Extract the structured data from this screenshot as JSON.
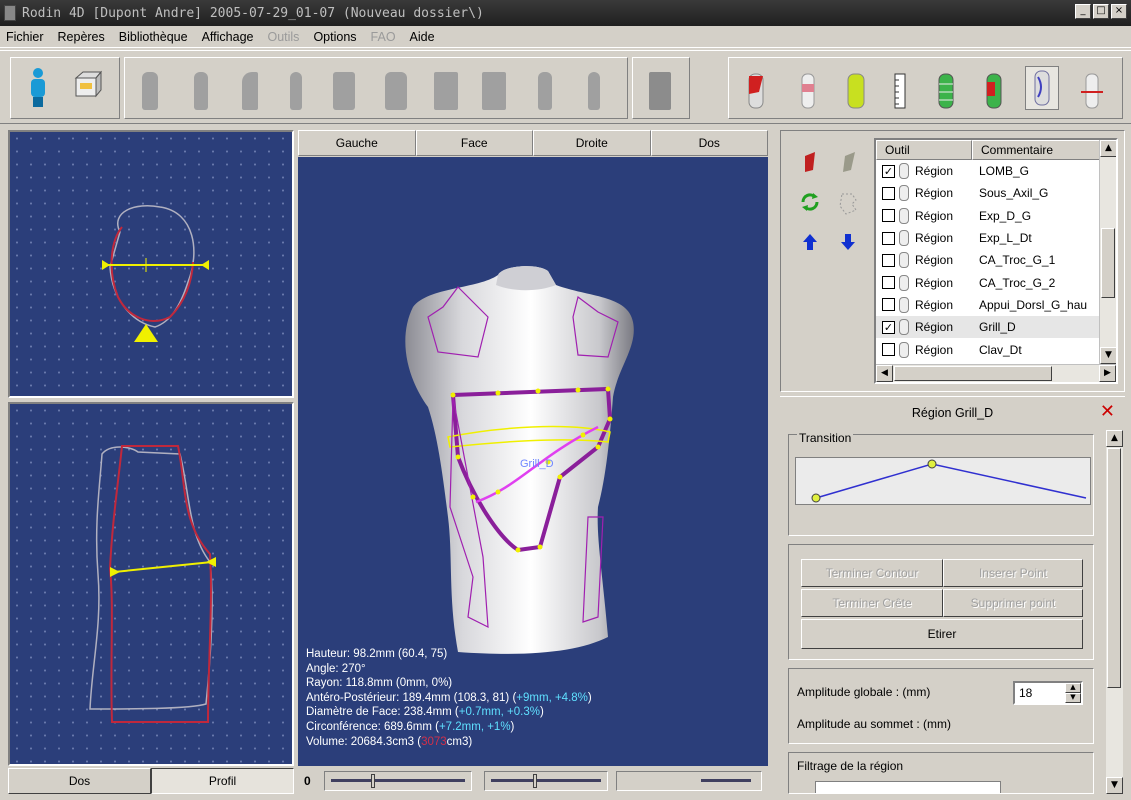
{
  "window": {
    "title": "Rodin 4D [Dupont Andre] 2005-07-29_01-07 (Nouveau dossier\\)",
    "minimize_glyph": "_",
    "maximize_glyph": "□",
    "close_glyph": "×"
  },
  "menu": {
    "items": [
      {
        "label": "Fichier",
        "enabled": true
      },
      {
        "label": "Repères",
        "enabled": true
      },
      {
        "label": "Bibliothèque",
        "enabled": true
      },
      {
        "label": "Affichage",
        "enabled": true
      },
      {
        "label": "Outils",
        "enabled": false
      },
      {
        "label": "Options",
        "enabled": true
      },
      {
        "label": "FAO",
        "enabled": false
      },
      {
        "label": "Aide",
        "enabled": true
      }
    ]
  },
  "toolbar": {
    "icons": [
      "patient-icon",
      "scan-box-icon",
      "torso-shape-1-icon",
      "torso-shape-2-icon",
      "torso-shape-3-icon",
      "torso-shape-4-icon",
      "torso-shape-5-icon",
      "torso-shape-6-icon",
      "torso-shape-7-icon",
      "torso-shape-8-icon",
      "torso-shape-9-icon",
      "torso-shape-10-icon",
      "torso-export-icon",
      "region-red-icon",
      "region-pink-icon",
      "region-yellow-icon",
      "ruler-icon",
      "region-green-icon",
      "region-green-red-icon",
      "region-selected-icon",
      "region-cut-icon"
    ]
  },
  "left_views": {
    "bottom_tabs": [
      "Dos",
      "Profil"
    ],
    "active_tab": "Profil"
  },
  "view3d": {
    "tabs": [
      "Gauche",
      "Face",
      "Droite",
      "Dos"
    ],
    "region_label": "Grill_D",
    "info_lines": [
      {
        "label": "Hauteur: 98.2mm (60.4, 75)"
      },
      {
        "label": "Angle: 270°"
      },
      {
        "label": "Rayon: 118.8mm (0mm, 0%)"
      },
      {
        "label": "Antéro-Postérieur: 189.4mm (108.3, 81) (",
        "hl": "+9mm, +4.8%",
        "end": ")"
      },
      {
        "label": "Diamètre de Face: 238.4mm (",
        "hl": "+0.7mm, +0.3%",
        "end": ")"
      },
      {
        "label": "Circonférence: 689.6mm (",
        "hl": "+7.2mm, +1%",
        "end": ")"
      },
      {
        "label": "Volume: 20684.3cm3 (",
        "red": "3073",
        "end": "cm3)"
      }
    ],
    "slider_value": "0"
  },
  "region_list": {
    "headers": [
      "Outil",
      "Commentaire"
    ],
    "rows": [
      {
        "checked": true,
        "tool": "Région",
        "comment": "LOMB_G"
      },
      {
        "checked": false,
        "tool": "Région",
        "comment": "Sous_Axil_G"
      },
      {
        "checked": false,
        "tool": "Région",
        "comment": "Exp_D_G"
      },
      {
        "checked": false,
        "tool": "Région",
        "comment": "Exp_L_Dt"
      },
      {
        "checked": false,
        "tool": "Région",
        "comment": "CA_Troc_G_1"
      },
      {
        "checked": false,
        "tool": "Région",
        "comment": "CA_Troc_G_2"
      },
      {
        "checked": false,
        "tool": "Région",
        "comment": "Appui_Dorsl_G_hau"
      },
      {
        "checked": true,
        "tool": "Région",
        "comment": "Grill_D",
        "selected": true
      },
      {
        "checked": false,
        "tool": "Région",
        "comment": "Clav_Dt"
      }
    ]
  },
  "region_panel": {
    "title": "Région Grill_D",
    "transition_label": "Transition",
    "buttons": {
      "terminer_contour": "Terminer Contour",
      "inserer_point": "Inserer Point",
      "terminer_crete": "Terminer Crête",
      "supprimer_point": "Supprimer point",
      "etirer": "Etirer"
    },
    "amplitude_globale_label": "Amplitude globale : (mm)",
    "amplitude_globale_value": "18",
    "amplitude_sommet_label": "Amplitude au sommet : (mm)",
    "filtrage_label": "Filtrage de la région"
  },
  "colors": {
    "view_bg": "#2b3e7a",
    "contour_red": "#c0283c",
    "contour_gray": "#b0b0c0",
    "region_purple": "#8a1f9a",
    "marker_yellow": "#f0f000",
    "highlight_cyan": "#5fe0ff"
  }
}
